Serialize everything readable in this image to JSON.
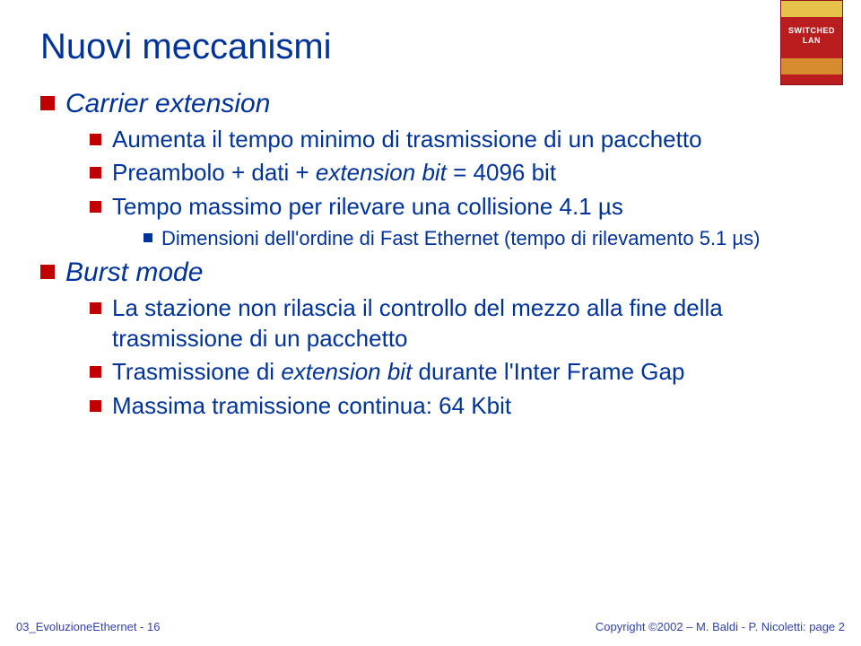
{
  "book": {
    "title_line1": "SWITCHED",
    "title_line2": "LAN"
  },
  "title": "Nuovi meccanismi",
  "items": [
    {
      "text": "Carrier extension",
      "children": [
        {
          "text": "Aumenta il tempo minimo di trasmissione di un pacchetto"
        },
        {
          "text_prefix": "Preambolo + dati + ",
          "text_italic": "extension bit",
          "text_suffix": " = 4096 bit"
        },
        {
          "text": "Tempo massimo per rilevare una collisione 4.1 µs",
          "children": [
            {
              "text": "Dimensioni dell'ordine di Fast Ethernet (tempo di rilevamento 5.1 µs)"
            }
          ]
        }
      ]
    },
    {
      "text": "Burst mode",
      "children": [
        {
          "text": "La stazione non rilascia il controllo del mezzo alla fine della trasmissione di un pacchetto"
        },
        {
          "text_prefix": "Trasmissione di ",
          "text_italic": "extension bit",
          "text_suffix": " durante l'Inter Frame Gap"
        },
        {
          "text": "Massima tramissione continua: 64 Kbit"
        }
      ]
    }
  ],
  "footer": {
    "left": "03_EvoluzioneEthernet - 16",
    "right": "Copyright ©2002 – M. Baldi - P. Nicoletti: page 2"
  }
}
